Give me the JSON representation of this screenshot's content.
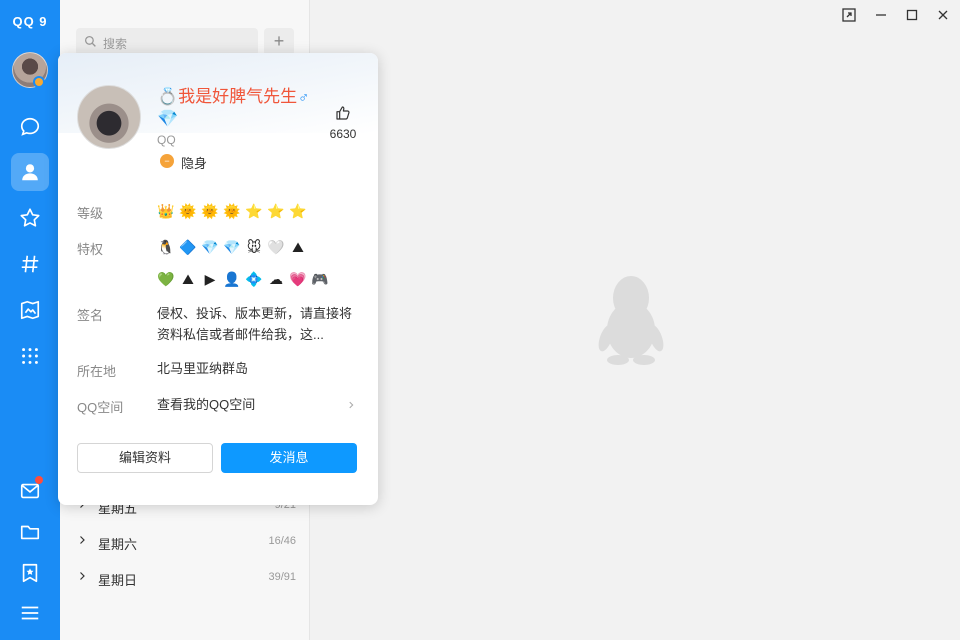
{
  "app": {
    "logo": "QQ 9"
  },
  "rail": {
    "items": [
      {
        "icon": "chat-bubble-icon"
      },
      {
        "icon": "contacts-icon",
        "active": true
      },
      {
        "icon": "star-icon"
      },
      {
        "icon": "hash-icon"
      },
      {
        "icon": "photo-icon"
      },
      {
        "icon": "apps-grid-icon"
      }
    ],
    "bottom": [
      {
        "icon": "mail-icon",
        "badge": true
      },
      {
        "icon": "folder-icon"
      },
      {
        "icon": "bookmark-icon"
      },
      {
        "icon": "menu-icon"
      }
    ]
  },
  "contacts": {
    "search_placeholder": "搜索",
    "add_label": "+",
    "groups": [
      {
        "name": "星期五",
        "count": "9/21"
      },
      {
        "name": "星期六",
        "count": "16/46"
      },
      {
        "name": "星期日",
        "count": "39/91"
      }
    ]
  },
  "profile": {
    "nickname_prefix": "💍",
    "nickname": "我是好脾气先生💎",
    "gender": "♂",
    "likes": "6630",
    "account_label": "QQ",
    "status": "隐身",
    "level_label": "等级",
    "level_icons": [
      "👑",
      "🌞",
      "🌞",
      "🌞",
      "⭐",
      "⭐",
      "⭐"
    ],
    "privilege_label": "特权",
    "privilege_icons_row1": [
      "🐧",
      "🔷",
      "💎",
      "💎",
      "🐭",
      "🤍",
      "⛰"
    ],
    "privilege_icons_row2": [
      "💚",
      "⛰",
      "▶",
      "👤",
      "💠",
      "☁",
      "💗",
      "🎮"
    ],
    "signature_label": "签名",
    "signature": "侵权、投诉、版本更新，请直接将资料私信或者邮件给我，这...",
    "location_label": "所在地",
    "location": "北马里亚纳群岛",
    "qzone_label": "QQ空间",
    "qzone_value": "查看我的QQ空间",
    "edit_button": "编辑资料",
    "send_button": "发消息"
  },
  "colors": {
    "rail": "#1a8cf5",
    "nickname": "#f0563a",
    "send_button": "#0e99ff"
  }
}
